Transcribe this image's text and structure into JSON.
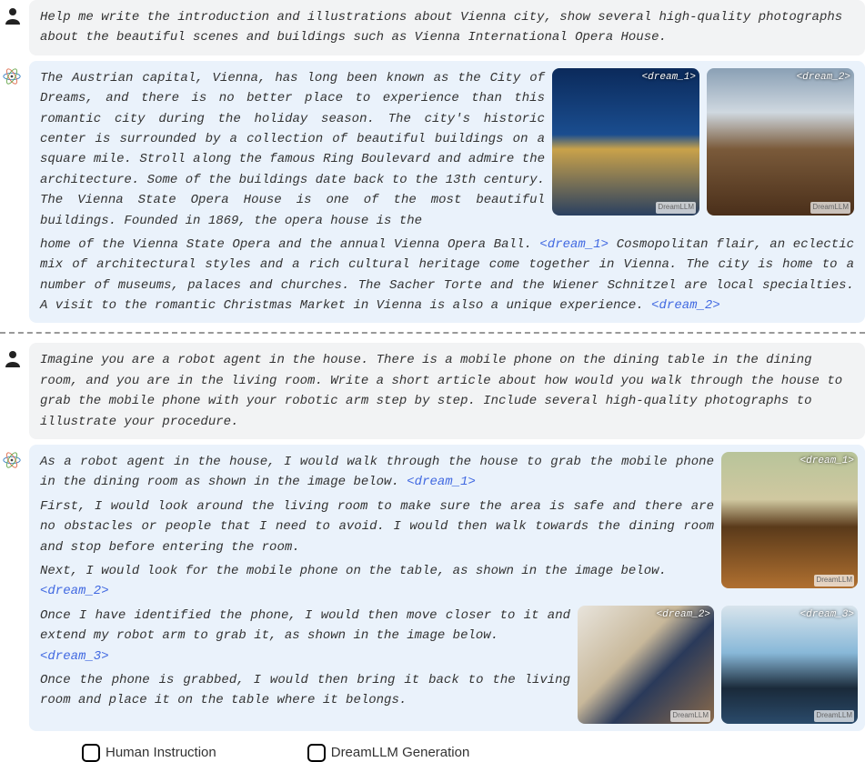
{
  "block1": {
    "human_prompt": "Help me write the introduction and illustrations about Vienna city, show several high-quality photographs about the beautiful scenes and buildings such as Vienna International Opera House.",
    "model_text_top": "The Austrian capital, Vienna, has long been known as the City of Dreams, and there is no better place to experience than this romantic city during the holiday season. The city's historic center is surrounded by a collection of beautiful buildings on a square mile. Stroll along the famous Ring Boulevard and admire the architecture. Some of the buildings date back to the 13th century. The Vienna State Opera House is one of the most beautiful buildings. Founded in 1869, the opera house is the",
    "model_text_bottom_a": "home of the Vienna State Opera and the annual Vienna Opera Ball. ",
    "dream1_ref": "<dream_1>",
    "model_text_bottom_b": " Cosmopolitan flair, an eclectic mix of architectural styles and a rich cultural heritage come together in Vienna. The city is home to a number of museums, palaces and churches. The Sacher Torte and the Wiener Schnitzel are local specialties. A visit to the romantic Christmas Market in Vienna is also a unique experience. ",
    "dream2_ref": "<dream_2>",
    "img1_label": "<dream_1>",
    "img2_label": "<dream_2>",
    "watermark": "DreamLLM"
  },
  "block2": {
    "human_prompt": "Imagine you are a robot agent in the house. There is a mobile phone on the dining table in the dining room, and you are in the living room. Write a short article about how would you walk through the house to grab the mobile phone with your robotic arm step by step. Include several high-quality photographs to illustrate your procedure.",
    "p1a": "As a robot agent in the house, I would walk through the house to grab the mobile phone in the dining room as shown in the image below. ",
    "d1": "<dream_1>",
    "p2": "First, I would look around the living room to make sure the area is safe and there are no obstacles or people that I need to avoid. I would then walk towards the dining room and stop before entering the room.",
    "p3a": "Next, I would look for the mobile phone on the table, as shown in the image below. ",
    "d2": "<dream_2>",
    "p4a": "Once I have identified the phone, I would then move closer to it and extend my robot arm to grab it, as shown in the image below. ",
    "d3": "<dream_3>",
    "p5": "Once the phone is grabbed, I would then bring it back to the living room and place it on the table where it belongs.",
    "img1_label": "<dream_1>",
    "img2_label": "<dream_2>",
    "img3_label": "<dream_3>",
    "watermark": "DreamLLM"
  },
  "legend": {
    "human": "Human Instruction",
    "model": "DreamLLM Generation"
  }
}
